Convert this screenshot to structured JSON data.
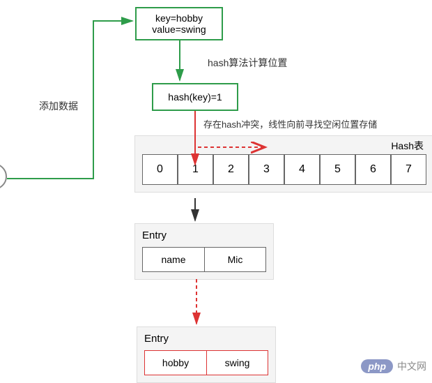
{
  "boxes": {
    "kv": {
      "line1": "key=hobby",
      "line2": "value=swing"
    },
    "hash": "hash(key)=1"
  },
  "labels": {
    "addData": "添加数据",
    "hashAlgo": "hash算法计算位置",
    "hashConflict": "存在hash冲突，线性向前寻找空闲位置存储",
    "hashTable": "Hash表"
  },
  "cells": [
    "0",
    "1",
    "2",
    "3",
    "4",
    "5",
    "6",
    "7"
  ],
  "entry1": {
    "title": "Entry",
    "key": "name",
    "value": "Mic"
  },
  "entry2": {
    "title": "Entry",
    "key": "hobby",
    "value": "swing"
  },
  "watermark": {
    "badge": "php",
    "text": "中文网"
  },
  "chart_data": {
    "type": "diagram",
    "description": "Hash table insertion with linear probing collision resolution",
    "input": {
      "key": "hobby",
      "value": "swing"
    },
    "hash_result": 1,
    "table_size": 8,
    "existing_entry_at_1": {
      "key": "name",
      "value": "Mic"
    },
    "collision": true,
    "resolution": "linear probing forward",
    "new_entry": {
      "key": "hobby",
      "value": "swing"
    }
  }
}
